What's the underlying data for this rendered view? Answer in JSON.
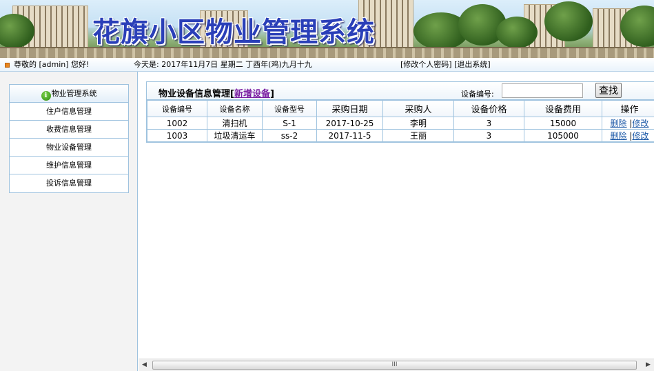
{
  "banner": {
    "title": "花旗小区物业管理系统"
  },
  "infobar": {
    "welcome": "尊敬的 [admin] 您好!",
    "date": "今天是: 2017年11月7日 星期二 丁酉年(鸡)九月十九",
    "change_password": "[修改个人密码]",
    "logout": "[退出系统]"
  },
  "sidebar": {
    "header": "物业管理系统",
    "items": [
      {
        "label": "住户信息管理"
      },
      {
        "label": "收费信息管理"
      },
      {
        "label": "物业设备管理"
      },
      {
        "label": "维护信息管理"
      },
      {
        "label": "投诉信息管理"
      }
    ]
  },
  "main": {
    "title": "物业设备信息管理",
    "add_link": "新增设备",
    "search": {
      "label": "设备编号:",
      "value": "",
      "button": "查找"
    },
    "columns": [
      "设备编号",
      "设备名称",
      "设备型号",
      "采购日期",
      "采购人",
      "设备价格",
      "设备费用",
      "操作"
    ],
    "rows": [
      {
        "id": "1002",
        "name": "清扫机",
        "model": "S-1",
        "date": "2017-10-25",
        "buyer": "李明",
        "price": "3",
        "cost": "15000",
        "delete": "删除",
        "edit": "修改"
      },
      {
        "id": "1003",
        "name": "垃圾清运车",
        "model": "ss-2",
        "date": "2017-11-5",
        "buyer": "王丽",
        "price": "3",
        "cost": "105000",
        "delete": "删除",
        "edit": "修改"
      }
    ]
  },
  "scrollbar": {
    "left_arrow": "◀",
    "right_arrow": "▶",
    "grip": "III"
  }
}
